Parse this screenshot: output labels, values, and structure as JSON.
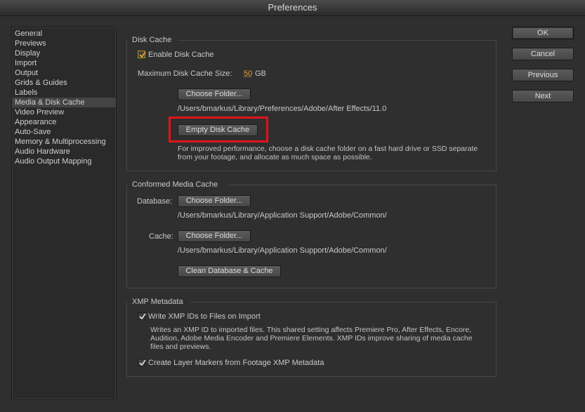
{
  "window": {
    "title": "Preferences"
  },
  "sidebar": {
    "items": [
      {
        "label": "General"
      },
      {
        "label": "Previews"
      },
      {
        "label": "Display"
      },
      {
        "label": "Import"
      },
      {
        "label": "Output"
      },
      {
        "label": "Grids & Guides"
      },
      {
        "label": "Labels"
      },
      {
        "label": "Media & Disk Cache",
        "selected": true
      },
      {
        "label": "Video Preview"
      },
      {
        "label": "Appearance"
      },
      {
        "label": "Auto-Save"
      },
      {
        "label": "Memory & Multiprocessing"
      },
      {
        "label": "Audio Hardware"
      },
      {
        "label": "Audio Output Mapping"
      }
    ]
  },
  "disk_cache": {
    "title": "Disk Cache",
    "enable_label": "Enable Disk Cache",
    "enable_checked": true,
    "max_size_label": "Maximum Disk Cache Size:",
    "max_size_value": "50",
    "max_size_unit": "GB",
    "choose_folder_label": "Choose Folder...",
    "folder_path": "/Users/bmarkus/Library/Preferences/Adobe/After Effects/11.0",
    "empty_cache_label": "Empty Disk Cache",
    "hint_line1": "For improved performance, choose a disk cache folder on a fast hard drive or SSD separate",
    "hint_line2": "from your footage, and allocate as much space as possible."
  },
  "conformed_cache": {
    "title": "Conformed Media Cache",
    "database_label": "Database:",
    "database_button": "Choose Folder...",
    "database_path": "/Users/bmarkus/Library/Application Support/Adobe/Common/",
    "cache_label": "Cache:",
    "cache_button": "Choose Folder...",
    "cache_path": "/Users/bmarkus/Library/Application Support/Adobe/Common/",
    "clean_label": "Clean Database & Cache"
  },
  "xmp": {
    "title": "XMP Metadata",
    "write_ids_label": "Write XMP IDs to Files on Import",
    "write_ids_checked": true,
    "desc_line1": "Writes an XMP ID to imported files. This shared setting affects Premiere Pro, After Effects, Encore,",
    "desc_line2": "Audition, Adobe Media Encoder and Premiere Elements. XMP IDs improve sharing of media cache",
    "desc_line3": "files and previews.",
    "layer_markers_label": "Create Layer Markers from Footage XMP Metadata",
    "layer_markers_checked": true
  },
  "buttons": {
    "ok": "OK",
    "cancel": "Cancel",
    "previous": "Previous",
    "next": "Next"
  },
  "colors": {
    "highlight": "#e0141d",
    "value_accent": "#e3a33c"
  }
}
